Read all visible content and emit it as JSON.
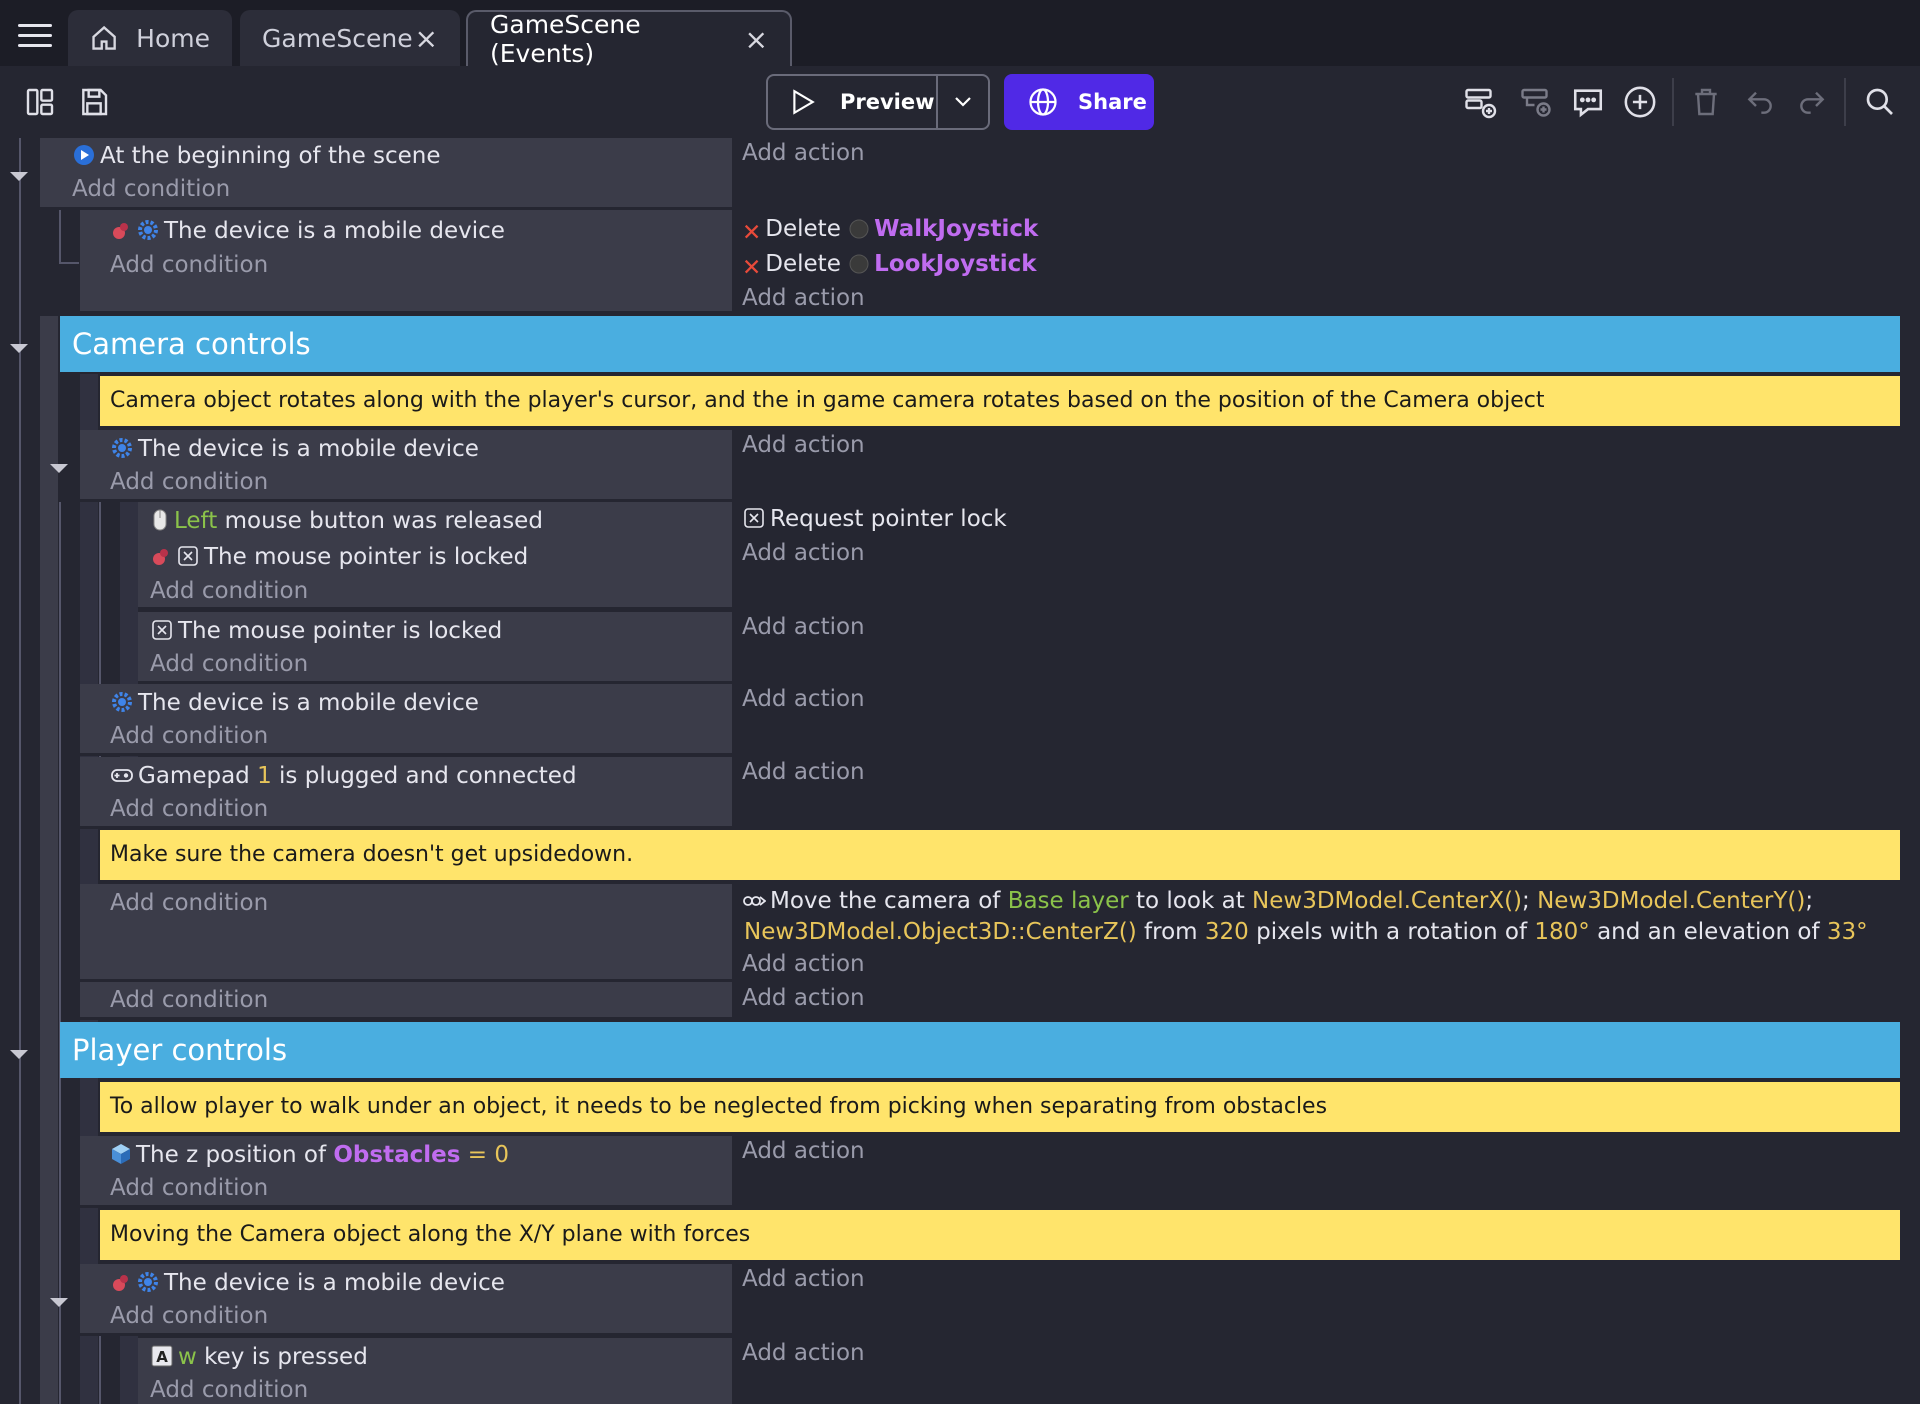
{
  "tabs": [
    {
      "label": "Home"
    },
    {
      "label": "GameScene"
    },
    {
      "label": "GameScene (Events)"
    }
  ],
  "toolbar": {
    "preview_label": "Preview",
    "share_label": "Share"
  },
  "labels": {
    "add_condition": "Add condition",
    "add_action": "Add action",
    "delete": "Delete"
  },
  "events": {
    "scene_start": "At the beginning of the scene",
    "mobile_device": "The device is a mobile device",
    "walk_joystick": "WalkJoystick",
    "look_joystick": "LookJoystick",
    "group_camera": "Camera controls",
    "comment_camera": "Camera object rotates along with the player's cursor, and the in game camera rotates based on the position of the Camera object",
    "left_word": "Left",
    "mouse_released_suffix": " mouse button was released",
    "pointer_locked": "The mouse pointer is locked",
    "request_pointer_lock": "Request pointer lock",
    "gamepad_prefix": "Gamepad ",
    "gamepad_num": "1",
    "gamepad_suffix": " is plugged and connected",
    "comment_upside": "Make sure the camera doesn't get upsidedown.",
    "move_cam_1": "Move the camera of ",
    "base_layer": "Base layer",
    "move_cam_2": " to look at ",
    "expr_x": "New3DModel.CenterX()",
    "sep": "; ",
    "expr_y": "New3DModel.CenterY()",
    "semicolon": ";",
    "expr_z": "New3DModel.Object3D::CenterZ()",
    "from_text": " from ",
    "distance": "320",
    "rot_text": " pixels with a rotation of ",
    "rotation": "180°",
    "elev_text": " and an elevation of ",
    "elevation": "33°",
    "group_player": "Player controls",
    "comment_walk": "To allow player to walk under an object, it needs to be neglected from picking when separating from obstacles",
    "z_pos_prefix": "The z position of ",
    "obstacles": "Obstacles",
    "equals": " = ",
    "zero": "0",
    "comment_forces": "Moving the Camera object along the X/Y plane with forces",
    "key_w": "w",
    "key_pressed_suffix": " key is pressed"
  }
}
